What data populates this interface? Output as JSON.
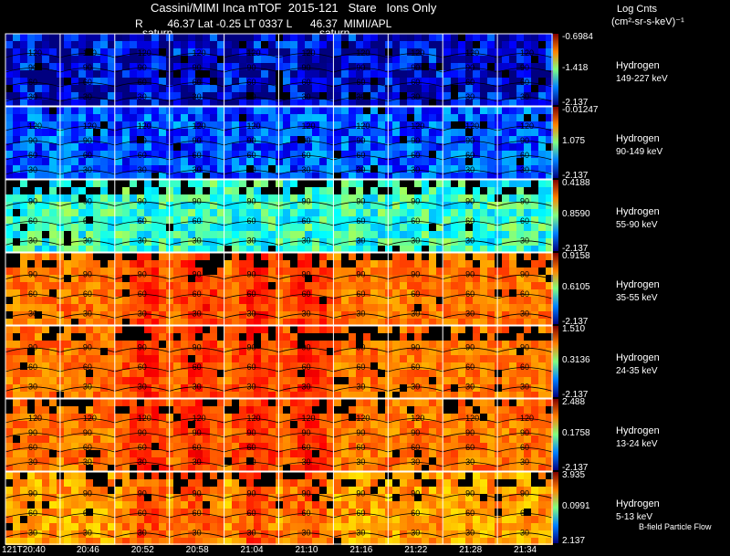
{
  "header": {
    "title": "Cassini/MIMI Inca mTOF  2015-121   Stare   Ions Only",
    "subtitle": "R        46.37 Lat -0.25 LT 0337 L      46.37  MIMI/APL",
    "saturn_labels": [
      "saturn",
      "saturn"
    ],
    "units_line1": "Log Cnts",
    "units_line2": "(cm²-sr-s-keV)⁻¹"
  },
  "panels": [
    {
      "species": "Hydrogen",
      "energy": "149-227 keV",
      "cb_max": "-0.6984",
      "cb_mid": "-1.418",
      "cb_min": "-2.137",
      "palette": "cool",
      "contours": [
        "120",
        "90",
        "60",
        "30"
      ]
    },
    {
      "species": "Hydrogen",
      "energy": "90-149 keV",
      "cb_max": "-0.01247",
      "cb_mid": "1.075",
      "cb_min": "-2.137",
      "palette": "cool2",
      "contours": [
        "120",
        "90",
        "60",
        "30"
      ]
    },
    {
      "species": "Hydrogen",
      "energy": "55-90 keV",
      "cb_max": "0.4188",
      "cb_mid": "0.8590",
      "cb_min": "-2.137",
      "palette": "mid",
      "contours": [
        "90",
        "60",
        "30"
      ]
    },
    {
      "species": "Hydrogen",
      "energy": "35-55 keV",
      "cb_max": "0.9158",
      "cb_mid": "0.6105",
      "cb_min": "-2.137",
      "palette": "warm",
      "contours": [
        "90",
        "60",
        "30"
      ]
    },
    {
      "species": "Hydrogen",
      "energy": "24-35 keV",
      "cb_max": "1.510",
      "cb_mid": "0.3136",
      "cb_min": "-2.137",
      "palette": "warm",
      "contours": [
        "90",
        "60",
        "30"
      ]
    },
    {
      "species": "Hydrogen",
      "energy": "13-24 keV",
      "cb_max": "2.488",
      "cb_mid": "0.1758",
      "cb_min": "-2.137",
      "palette": "warm",
      "contours": [
        "120",
        "90",
        "60",
        "30"
      ]
    },
    {
      "species": "Hydrogen",
      "energy": "5-13 keV",
      "cb_max": "3.935",
      "cb_mid": "0.0991",
      "cb_min": "2.137",
      "palette": "warm2",
      "contours": [
        "90",
        "60",
        "30"
      ]
    }
  ],
  "time_labels": [
    "121T20:40",
    "20:46",
    "20:52",
    "20:58",
    "21:04",
    "21:10",
    "21:16",
    "21:22",
    "21:28",
    "21:34"
  ],
  "bfield_label": "B-field Particle Flow",
  "colors": {
    "grid": "#ffffff",
    "contour": "#000000",
    "background": "#000000"
  }
}
